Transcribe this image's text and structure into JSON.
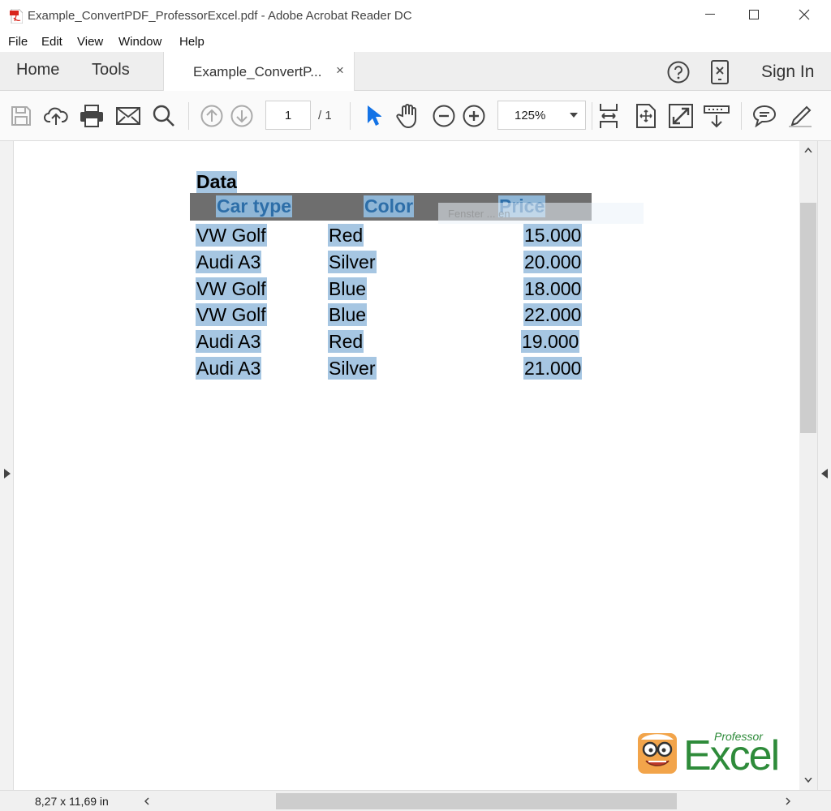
{
  "window": {
    "title": "Example_ConvertPDF_ProfessorExcel.pdf - Adobe Acrobat Reader DC"
  },
  "menu": [
    "File",
    "Edit",
    "View",
    "Window",
    "Help"
  ],
  "tabs": {
    "home": "Home",
    "tools": "Tools",
    "document": "Example_ConvertP...",
    "close": "×",
    "sign_in": "Sign In"
  },
  "toolbar": {
    "page_current": "1",
    "page_total": "/ 1",
    "zoom": "125%"
  },
  "document": {
    "heading": "Data",
    "table": {
      "headers": [
        "Car type",
        "Color",
        "Price"
      ],
      "rows": [
        [
          "VW Golf",
          "Red",
          "15.000"
        ],
        [
          "Audi A3",
          "Silver",
          "20.000"
        ],
        [
          "VW Golf",
          "Blue",
          "18.000"
        ],
        [
          "VW Golf",
          "Blue",
          "22.000"
        ],
        [
          "Audi A3",
          "Red",
          "19.000"
        ],
        [
          "Audi A3",
          "Silver",
          "21.000"
        ]
      ]
    },
    "overlay_hint": "Fenster ... en",
    "logo": {
      "small": "Professor",
      "big": "Excel"
    }
  },
  "status": {
    "page_size": "8,27 x 11,69 in"
  },
  "colors": {
    "selection": "#a6c6e2",
    "header_bg": "#6e6e6e",
    "acrobat_red": "#d9261c",
    "cursor_blue": "#1473e6",
    "logo_green": "#2e8b3a"
  }
}
